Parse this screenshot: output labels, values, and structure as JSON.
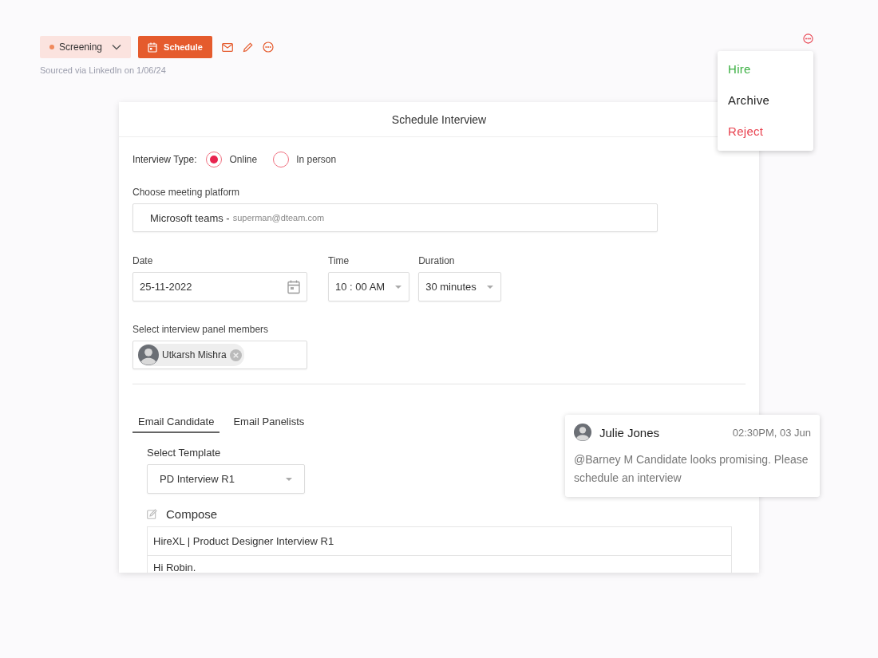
{
  "toolbar": {
    "status": "Screening",
    "schedule_button": "Schedule",
    "source": "Sourced via LinkedIn on 1/06/24"
  },
  "actions_menu": [
    {
      "label": "Hire",
      "color": "#3cb043"
    },
    {
      "label": "Archive",
      "color": "#222222"
    },
    {
      "label": "Reject",
      "color": "#e8424f"
    }
  ],
  "dialog": {
    "title": "Schedule Interview",
    "interview_type": {
      "label": "Interview Type:",
      "options": [
        {
          "label": "Online",
          "selected": true
        },
        {
          "label": "In person",
          "selected": false
        }
      ]
    },
    "platform": {
      "label": "Choose meeting platform",
      "value": "Microsoft teams -",
      "account": "superman@dteam.com"
    },
    "date": {
      "label": "Date",
      "value": "25-11-2022"
    },
    "time": {
      "label": "Time",
      "value": "10 : 00 AM"
    },
    "duration": {
      "label": "Duration",
      "value": "30 minutes"
    },
    "panel": {
      "label": "Select interview panel members",
      "members": [
        "Utkarsh Mishra"
      ]
    },
    "tabs": [
      {
        "label": "Email Candidate",
        "selected": true
      },
      {
        "label": "Email Panelists",
        "selected": false
      }
    ],
    "template": {
      "label": "Select Template",
      "value": "PD Interview R1"
    },
    "compose": {
      "label": "Compose",
      "subject": "HireXL | Product Designer Interview R1",
      "body": "Hi Robin."
    }
  },
  "comment": {
    "author": "Julie Jones",
    "time": "02:30PM, 03 Jun",
    "text": "@Barney M Candidate looks promising. Please schedule an interview"
  }
}
